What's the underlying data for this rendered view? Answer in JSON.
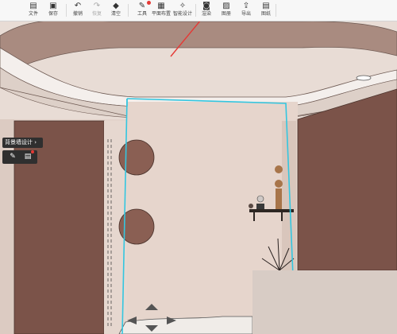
{
  "toolbar": {
    "file": "文件",
    "save": "保存",
    "undo": "撤销",
    "redo": "恢复",
    "clear": "清空",
    "tools": "工具",
    "floor_plan": "平面布置",
    "smart_design": "智能设计",
    "render": "渲染",
    "album": "图册",
    "export": "导出",
    "drawings": "图纸"
  },
  "icons": {
    "file": "file-icon",
    "save": "save-icon",
    "undo": "undo-icon",
    "redo": "redo-icon",
    "clear": "eraser-icon",
    "tools": "wrench-icon",
    "floor_plan": "floor-plan-icon",
    "smart_design": "magic-icon",
    "render": "camera-icon",
    "album": "album-icon",
    "export": "export-icon",
    "drawings": "drawings-icon"
  },
  "panel": {
    "title": "背景墙设计",
    "title_chevron": "›",
    "tools": [
      "edit-pencil",
      "layout"
    ]
  },
  "colors": {
    "toolbar_bg": "#f7f7f7",
    "wall_main": "#e3d3cb",
    "wall_dark": "#7a5348",
    "selection": "#33c6e0",
    "alert_red": "#e53935"
  }
}
